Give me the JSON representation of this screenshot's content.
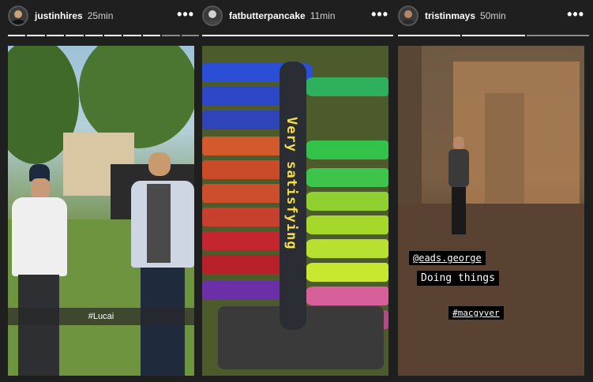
{
  "stories": [
    {
      "username": "justinhires",
      "time": "25min",
      "more_icon": "more-horizontal-icon",
      "caption": "#Lucai",
      "progress_segments": 10,
      "progress_viewed": 8
    },
    {
      "username": "fatbutterpancake",
      "time": "11min",
      "more_icon": "more-horizontal-icon",
      "text_overlay": "Very satisfying",
      "progress_segments": 1,
      "progress_viewed": 1
    },
    {
      "username": "tristinmays",
      "time": "50min",
      "more_icon": "more-horizontal-icon",
      "mention": "@eads.george",
      "text": "Doing things",
      "hashtag": "#macgyver",
      "progress_segments": 3,
      "progress_viewed": 2
    }
  ],
  "more_glyph": "•••"
}
